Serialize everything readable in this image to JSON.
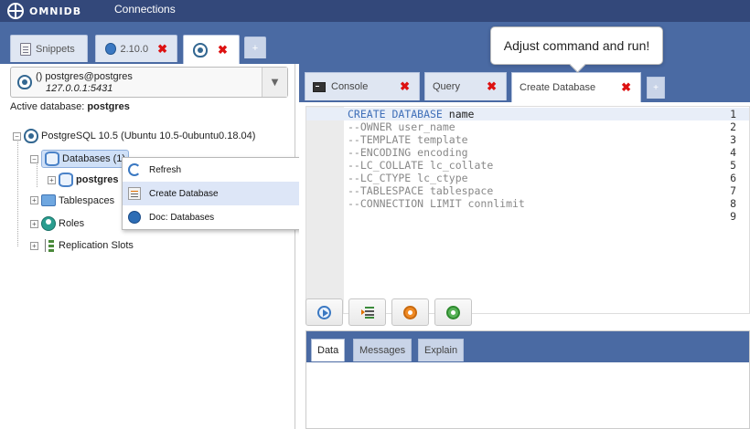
{
  "topbar": {
    "logo_text": "OMNIDB",
    "nav_connections": "Connections"
  },
  "outer_tabs": [
    {
      "label": "Snippets",
      "icon": "document-icon"
    },
    {
      "label": "2.10.0",
      "icon": "globe-icon",
      "closable": true
    },
    {
      "label": "",
      "icon": "postgresql-icon",
      "closable": true,
      "active": true
    },
    {
      "label": "+",
      "icon": "add-icon"
    }
  ],
  "connection": {
    "name": "() postgres@postgres",
    "host": "127.0.0.1:5431",
    "dropdown_icon": "▼"
  },
  "active_database": {
    "label": "Active database:",
    "value": "postgres"
  },
  "tree": {
    "server": "PostgreSQL 10.5 (Ubuntu 10.5-0ubuntu0.18.04)",
    "databases": "Databases (1)",
    "database_child": "postgres",
    "tablespaces": "Tablespaces",
    "roles": "Roles",
    "replication_slots": "Replication Slots"
  },
  "context_menu": {
    "items": [
      {
        "label": "Refresh",
        "icon": "refresh-icon"
      },
      {
        "label": "Create Database",
        "icon": "create-database-icon"
      },
      {
        "label": "Doc: Databases",
        "icon": "doc-globe-icon"
      }
    ]
  },
  "inner_tabs": [
    {
      "label": "Console",
      "icon": "console-icon",
      "closable": true
    },
    {
      "label": "Query",
      "closable": true
    },
    {
      "label": "Create Database",
      "closable": true,
      "active": true
    },
    {
      "label": "+"
    }
  ],
  "editor": {
    "lines": [
      {
        "no": "1",
        "text": "CREATE DATABASE name"
      },
      {
        "no": "2",
        "text": "--OWNER user_name"
      },
      {
        "no": "3",
        "text": "--TEMPLATE template"
      },
      {
        "no": "4",
        "text": "--ENCODING encoding"
      },
      {
        "no": "5",
        "text": "--LC_COLLATE lc_collate"
      },
      {
        "no": "6",
        "text": "--LC_CTYPE lc_ctype"
      },
      {
        "no": "7",
        "text": "--TABLESPACE tablespace"
      },
      {
        "no": "8",
        "text": "--CONNECTION LIMIT connlimit"
      },
      {
        "no": "9",
        "text": ""
      }
    ],
    "keyword": "CREATE DATABASE",
    "keyword_rest": " name"
  },
  "toolbar_buttons": [
    {
      "icon": "run-icon"
    },
    {
      "icon": "indent-icon"
    },
    {
      "icon": "explain-icon"
    },
    {
      "icon": "explain-analyze-icon"
    }
  ],
  "result_tabs": [
    {
      "label": "Data",
      "active": true
    },
    {
      "label": "Messages"
    },
    {
      "label": "Explain"
    }
  ],
  "tooltip": {
    "text": "Adjust command and run!"
  },
  "colors": {
    "topbar": "#33487a",
    "tab_strip": "#4a6aa3",
    "close": "#dd1111",
    "keyword": "#3e6eb8"
  }
}
